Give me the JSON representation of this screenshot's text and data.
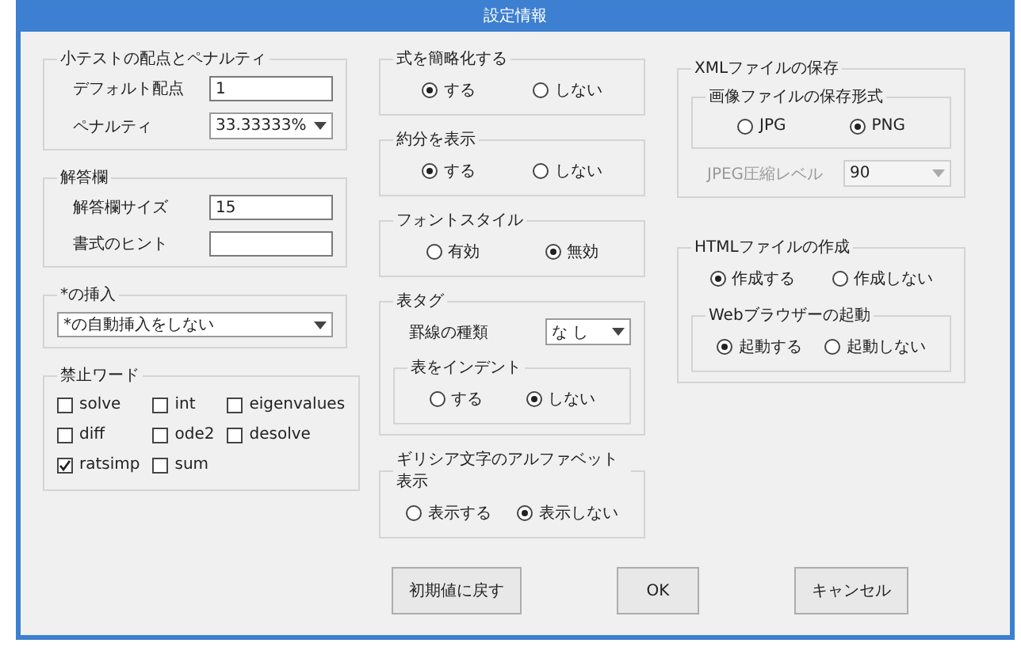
{
  "window": {
    "title": "設定情報"
  },
  "columns": [
    [
      {
        "title": "小テストの配点とペナルティ",
        "items": [
          {
            "kind": "field",
            "label": "デフォルト配点",
            "value": "1"
          },
          {
            "kind": "select",
            "label": "ペナルティ",
            "value": "33.33333%"
          }
        ]
      },
      {
        "title": "解答欄",
        "items": [
          {
            "kind": "field",
            "label": "解答欄サイズ",
            "value": "15"
          },
          {
            "kind": "field",
            "label": "書式のヒント",
            "value": ""
          }
        ]
      },
      {
        "title": "*の挿入",
        "items": [
          {
            "kind": "select",
            "value": "*の自動挿入をしない"
          }
        ]
      },
      {
        "title": "禁止ワード",
        "items": [
          {
            "kind": "checks",
            "options": [
              {
                "label": "solve",
                "checked": false
              },
              {
                "label": "int",
                "checked": false
              },
              {
                "label": "eigenvalues",
                "checked": false
              },
              {
                "label": "diff",
                "checked": false
              },
              {
                "label": "ode2",
                "checked": false
              },
              {
                "label": "desolve",
                "checked": false
              },
              {
                "label": "ratsimp",
                "checked": true
              },
              {
                "label": "sum",
                "checked": false
              }
            ]
          }
        ]
      }
    ],
    [
      {
        "title": "式を簡略化する",
        "items": [
          {
            "kind": "radios",
            "options": [
              {
                "label": "する",
                "selected": true
              },
              {
                "label": "しない",
                "selected": false
              }
            ]
          }
        ]
      },
      {
        "title": "約分を表示",
        "items": [
          {
            "kind": "radios",
            "options": [
              {
                "label": "する",
                "selected": true
              },
              {
                "label": "しない",
                "selected": false
              }
            ]
          }
        ]
      },
      {
        "title": "フォントスタイル",
        "items": [
          {
            "kind": "radios",
            "options": [
              {
                "label": "有効",
                "selected": false
              },
              {
                "label": "無効",
                "selected": true
              }
            ]
          }
        ]
      },
      {
        "title": "表タグ",
        "items": [
          {
            "kind": "select",
            "label": "罫線の種類",
            "value": "な し"
          },
          {
            "kind": "group",
            "title": "表をインデント",
            "items": [
              {
                "kind": "radios",
                "options": [
                  {
                    "label": "する",
                    "selected": false
                  },
                  {
                    "label": "しない",
                    "selected": true
                  }
                ]
              }
            ]
          }
        ]
      },
      {
        "title": "ギリシア文字のアルファベット表示",
        "items": [
          {
            "kind": "radios",
            "options": [
              {
                "label": "表示する",
                "selected": false
              },
              {
                "label": "表示しない",
                "selected": true
              }
            ]
          }
        ]
      }
    ],
    [
      {
        "title": "XMLファイルの保存",
        "items": [
          {
            "kind": "group",
            "title": "画像ファイルの保存形式",
            "items": [
              {
                "kind": "radios",
                "options": [
                  {
                    "label": "JPG",
                    "selected": false
                  },
                  {
                    "label": "PNG",
                    "selected": true
                  }
                ]
              }
            ]
          },
          {
            "kind": "select",
            "label": "JPEG圧縮レベル",
            "value": "90",
            "disabled": true
          }
        ]
      },
      {
        "title": "HTMLファイルの作成",
        "items": [
          {
            "kind": "radios",
            "options": [
              {
                "label": "作成する",
                "selected": true
              },
              {
                "label": "作成しない",
                "selected": false
              }
            ]
          },
          {
            "kind": "group",
            "title": "Webブラウザーの起動",
            "items": [
              {
                "kind": "radios",
                "options": [
                  {
                    "label": "起動する",
                    "selected": true
                  },
                  {
                    "label": "起動しない",
                    "selected": false
                  }
                ]
              }
            ]
          }
        ]
      }
    ]
  ],
  "buttons": [
    "初期値に戻す",
    "OK",
    "キャンセル"
  ]
}
